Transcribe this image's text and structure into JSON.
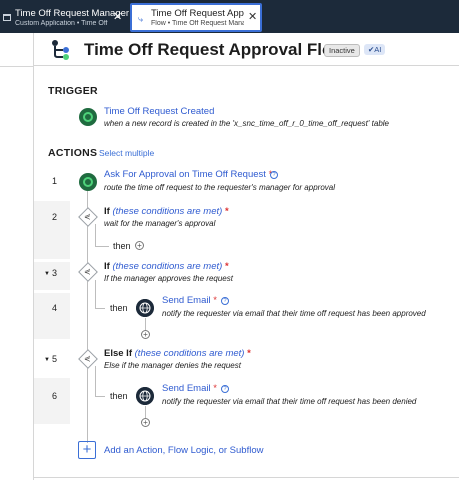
{
  "tabs": [
    {
      "title": "Time Off Request Manager",
      "subtitle": "Custom Application • Time Off R..."
    },
    {
      "title": "Time Off Request Approval Flow",
      "subtitle": "Flow • Time Off Request Manager"
    }
  ],
  "header": {
    "title": "Time Off Request Approval Flow",
    "status": "Inactive",
    "ai_badge": "AI"
  },
  "trigger": {
    "heading": "TRIGGER",
    "name": "Time Off Request Created",
    "description": "when a new record is created in the 'x_snc_time_off_r_0_time_off_request' table"
  },
  "actions": {
    "heading": "ACTIONS",
    "select_multiple": "Select multiple",
    "steps": [
      {
        "num": "1",
        "label": "Ask For Approval on Time Off Request",
        "desc": "route the time off request to the requester's manager for approval"
      },
      {
        "num": "2",
        "keyword": "If",
        "cond": "(these conditions are met)",
        "desc": "wait for the manager's approval",
        "then": "then"
      },
      {
        "num": "3",
        "keyword": "If",
        "cond": "(these conditions are met)",
        "desc": "If the manager approves the request"
      },
      {
        "num": "4",
        "then": "then",
        "label": "Send Email",
        "desc": "notify the requester via email that their time off request has been approved"
      },
      {
        "num": "5",
        "keyword": "Else If",
        "cond": "(these conditions are met)",
        "desc": "Else if the manager denies the request"
      },
      {
        "num": "6",
        "then": "then",
        "label": "Send Email",
        "desc": "notify the requester via email that their time off request has been denied"
      }
    ],
    "add_label": "Add an Action, Flow Logic, or Subflow"
  },
  "colors": {
    "accent": "#3b6fd6",
    "trigger_green": "#1f6b3f",
    "required": "#d33"
  },
  "icons": {
    "trigger": "trigger-dot-icon",
    "branch": "branch-diamond-icon",
    "email": "globe-icon",
    "info": "info-icon",
    "add": "plus-icon"
  }
}
